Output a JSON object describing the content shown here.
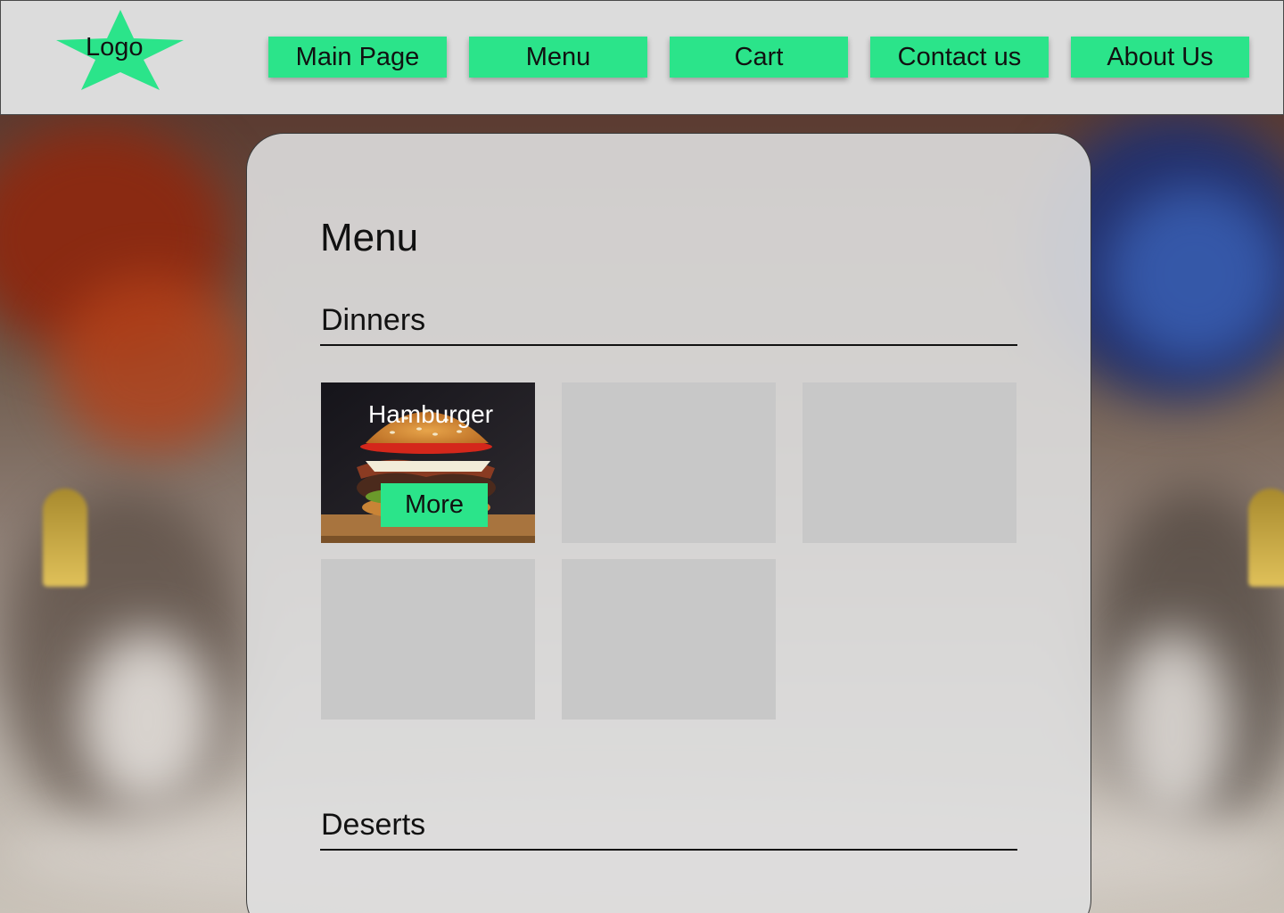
{
  "header": {
    "logo_label": "Logo",
    "nav": [
      "Main Page",
      "Menu",
      "Cart",
      "Contact us",
      "About Us"
    ]
  },
  "colors": {
    "accent": "#2be48a",
    "header_bg": "#dcdcdc",
    "panel_bg": "#dedede",
    "placeholder": "#c8c8c8"
  },
  "main": {
    "title": "Menu",
    "sections": [
      {
        "title": "Dinners",
        "items": [
          {
            "name": "Hamburger",
            "button": "More",
            "image": "hamburger-photo"
          },
          {
            "name": "",
            "button": ""
          },
          {
            "name": "",
            "button": ""
          },
          {
            "name": "",
            "button": ""
          },
          {
            "name": "",
            "button": ""
          }
        ]
      },
      {
        "title": "Deserts",
        "items": []
      }
    ]
  }
}
